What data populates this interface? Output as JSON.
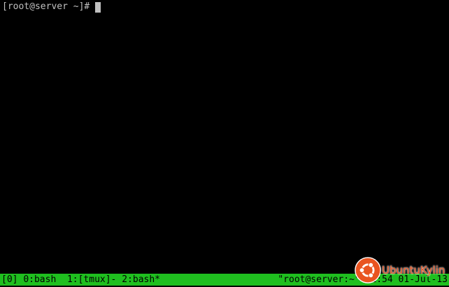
{
  "terminal": {
    "prompt": "[root@server ~]#"
  },
  "status_bar": {
    "session": "[0]",
    "windows": [
      {
        "label": "0:bash"
      },
      {
        "label": "1:[tmux]-"
      },
      {
        "label": "2:bash*"
      }
    ],
    "pane_title": "\"root@server:~\"",
    "time": "1:54",
    "date": "01-Jul-13",
    "bg_color": "#1fbf1f"
  },
  "watermark": {
    "text": "UbuntuKylin",
    "icon": "ubuntu-logo-icon",
    "color": "#e95420"
  }
}
